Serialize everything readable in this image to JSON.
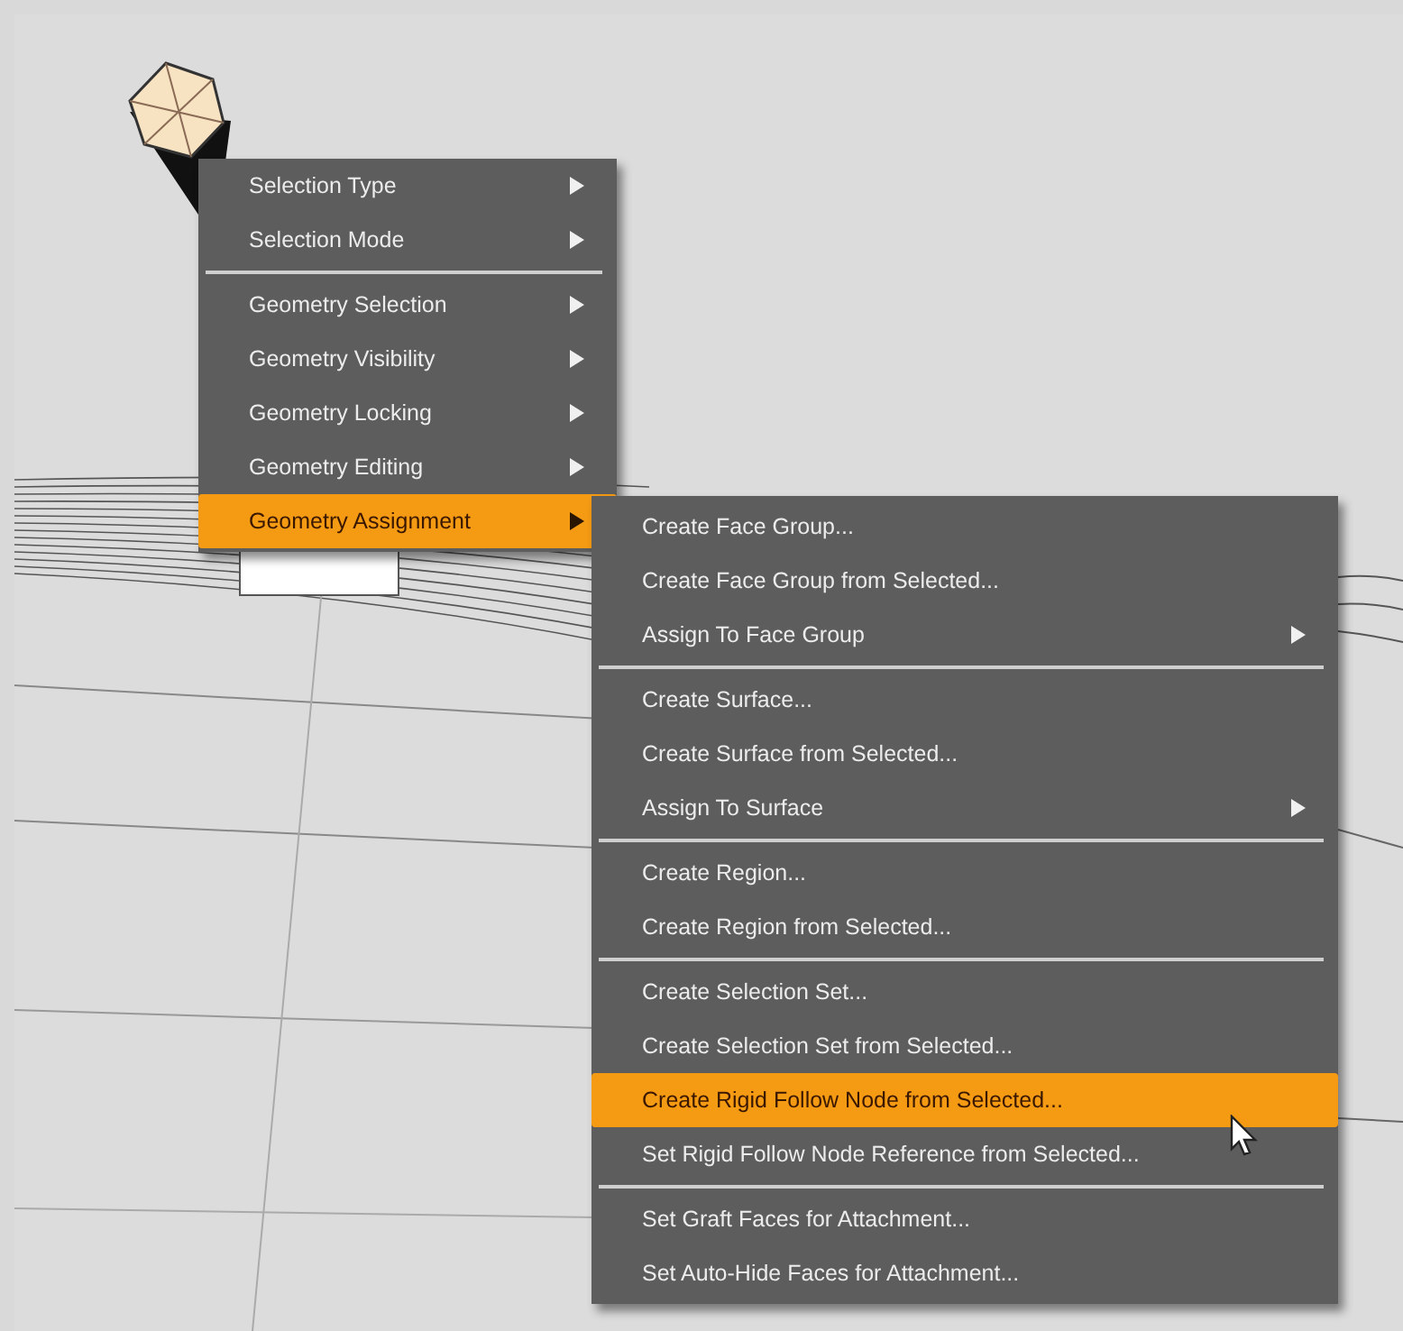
{
  "menus": [
    {
      "items": [
        {
          "kind": "item",
          "label": "Selection Type",
          "submenu": true,
          "selected": false
        },
        {
          "kind": "item",
          "label": "Selection Mode",
          "submenu": true,
          "selected": false
        },
        {
          "kind": "separator"
        },
        {
          "kind": "item",
          "label": "Geometry Selection",
          "submenu": true,
          "selected": false
        },
        {
          "kind": "item",
          "label": "Geometry Visibility",
          "submenu": true,
          "selected": false
        },
        {
          "kind": "item",
          "label": "Geometry Locking",
          "submenu": true,
          "selected": false
        },
        {
          "kind": "item",
          "label": "Geometry Editing",
          "submenu": true,
          "selected": false
        },
        {
          "kind": "item",
          "label": "Geometry Assignment",
          "submenu": true,
          "selected": true
        }
      ]
    },
    {
      "items": [
        {
          "kind": "item",
          "label": "Create Face Group...",
          "submenu": false,
          "selected": false
        },
        {
          "kind": "item",
          "label": "Create Face Group from Selected...",
          "submenu": false,
          "selected": false
        },
        {
          "kind": "item",
          "label": "Assign To Face Group",
          "submenu": true,
          "selected": false
        },
        {
          "kind": "separator"
        },
        {
          "kind": "item",
          "label": "Create Surface...",
          "submenu": false,
          "selected": false
        },
        {
          "kind": "item",
          "label": "Create Surface from Selected...",
          "submenu": false,
          "selected": false
        },
        {
          "kind": "item",
          "label": "Assign To Surface",
          "submenu": true,
          "selected": false
        },
        {
          "kind": "separator"
        },
        {
          "kind": "item",
          "label": "Create Region...",
          "submenu": false,
          "selected": false
        },
        {
          "kind": "item",
          "label": "Create Region from Selected...",
          "submenu": false,
          "selected": false
        },
        {
          "kind": "separator"
        },
        {
          "kind": "item",
          "label": "Create Selection Set...",
          "submenu": false,
          "selected": false
        },
        {
          "kind": "item",
          "label": "Create Selection Set from Selected...",
          "submenu": false,
          "selected": false
        },
        {
          "kind": "item",
          "label": "Create Rigid Follow Node from Selected...",
          "submenu": false,
          "selected": true
        },
        {
          "kind": "item",
          "label": "Set Rigid Follow Node Reference from Selected...",
          "submenu": false,
          "selected": false
        },
        {
          "kind": "separator"
        },
        {
          "kind": "item",
          "label": "Set Graft Faces for Attachment...",
          "submenu": false,
          "selected": false
        },
        {
          "kind": "item",
          "label": "Set Auto-Hide Faces for Attachment...",
          "submenu": false,
          "selected": false
        }
      ]
    }
  ]
}
